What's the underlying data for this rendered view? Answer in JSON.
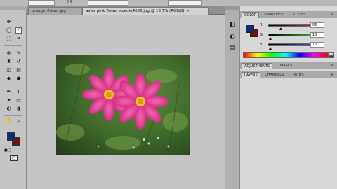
{
  "options_bar": {
    "field1_value": "",
    "number_value": "13",
    "field2_value": "",
    "field3_value": ""
  },
  "tabs": [
    {
      "label": "orange_flower.jpg"
    },
    {
      "label": "aster pink flower aoediu4656.jpg @ 16.7% (RGB/8)"
    }
  ],
  "color_panel": {
    "tabs": [
      "COLOR",
      "SWATCHES",
      "STYLES"
    ],
    "channels": [
      {
        "label": "R",
        "value": "96",
        "color": "#c03030"
      },
      {
        "label": "G",
        "value": "13",
        "color": "#30a030"
      },
      {
        "label": "B",
        "value": "12",
        "color": "#3050c8"
      }
    ],
    "foreground_color": "#0e2f6e",
    "background_color": "#6b1511"
  },
  "adjustments_panel": {
    "tabs": [
      "ADJUSTMENTS",
      "MASKS"
    ]
  },
  "layers_panel": {
    "tabs": [
      "LAYERS",
      "CHANNELS",
      "PATHS"
    ]
  },
  "tools": {
    "foreground_color": "#0f2e72",
    "background_color": "#6e1412"
  },
  "side_icons": [
    "color-icon",
    "adjustments-icon",
    "layers-icon"
  ]
}
